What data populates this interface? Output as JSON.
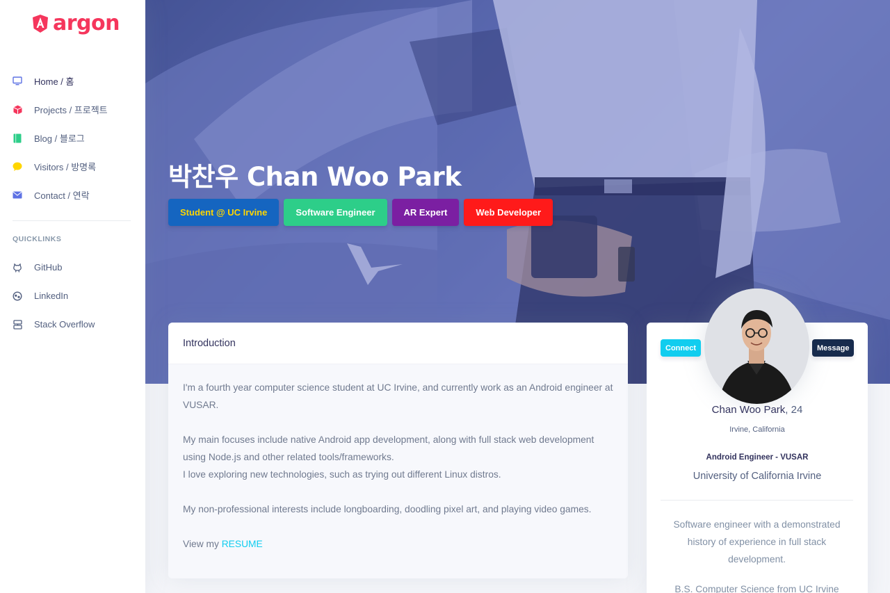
{
  "brand": {
    "name": "argon",
    "color": "#f5365c"
  },
  "nav": {
    "items": [
      {
        "label": "Home / 홈",
        "icon": "tv-icon",
        "color": "#5e72e4"
      },
      {
        "label": "Projects / 프로젝트",
        "icon": "cube-icon",
        "color": "#f5365c"
      },
      {
        "label": "Blog / 블로그",
        "icon": "book-icon",
        "color": "#2dce89"
      },
      {
        "label": "Visitors / 방명록",
        "icon": "chat-bubble-icon",
        "color": "#ffd600"
      },
      {
        "label": "Contact / 연락",
        "icon": "mail-icon",
        "color": "#5e72e4"
      }
    ]
  },
  "quicklinks": {
    "heading": "QUICKLINKS",
    "items": [
      {
        "label": "GitHub",
        "icon": "github-icon"
      },
      {
        "label": "LinkedIn",
        "icon": "linkedin-icon"
      },
      {
        "label": "Stack Overflow",
        "icon": "stack-overflow-icon"
      }
    ]
  },
  "hero": {
    "title": "박찬우 Chan Woo Park",
    "badges": [
      {
        "label": "Student @ UC Irvine",
        "bg": "#1565c0",
        "fg": "#ffd600"
      },
      {
        "label": "Software Engineer",
        "bg": "#2dce89",
        "fg": "#ffffff"
      },
      {
        "label": "AR Expert",
        "bg": "#7b1fa2",
        "fg": "#ffffff"
      },
      {
        "label": "Web Developer",
        "bg": "#ff1a1a",
        "fg": "#ffffff"
      }
    ]
  },
  "intro": {
    "header": "Introduction",
    "p1": "I'm a fourth year computer science student at UC Irvine, and currently work as an Android engineer at VUSAR.",
    "p2a": "My main focuses include native Android app development, along with full stack web development using Node.js and other related tools/frameworks.",
    "p2b": "I love exploring new technologies, such as trying out different Linux distros.",
    "p3": "My non-professional interests include longboarding, doodling pixel art, and playing video games.",
    "resume_prefix": "View my ",
    "resume_link": "RESUME"
  },
  "profile": {
    "connect_label": "Connect",
    "message_label": "Message",
    "name": "Chan Woo Park",
    "age": ", 24",
    "location": "Irvine, California",
    "job": "Android Engineer - VUSAR",
    "school": "University of California Irvine",
    "summary": "Software engineer with a demonstrated history of experience in full stack development.",
    "degree": "B.S. Computer Science from UC Irvine"
  }
}
